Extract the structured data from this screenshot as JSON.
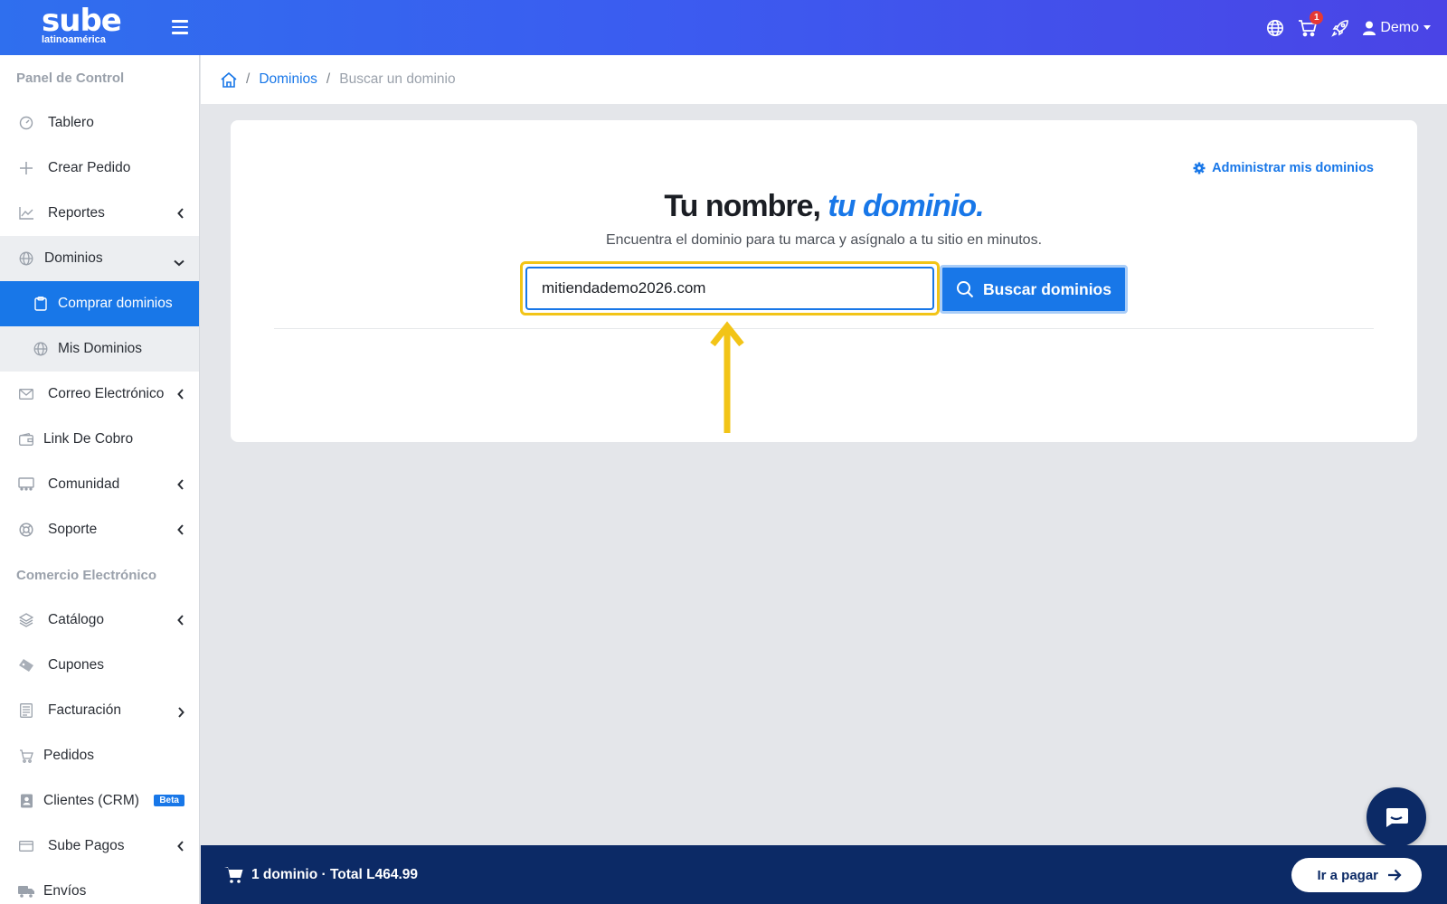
{
  "header": {
    "logo_main": "sube",
    "logo_sub": "latinoamérica",
    "cart_badge": "1",
    "user_name": "Demo"
  },
  "sidebar": {
    "section1_title": "Panel de Control",
    "items1": [
      {
        "label": "Tablero",
        "icon": "gauge-icon"
      },
      {
        "label": "Crear Pedido",
        "icon": "plus-icon"
      },
      {
        "label": "Reportes",
        "icon": "chart-line-icon"
      },
      {
        "label": "Dominios",
        "icon": "globe-icon"
      },
      {
        "label": "Comprar dominios",
        "icon": "clipboard-icon"
      },
      {
        "label": "Mis Dominios",
        "icon": "globe-icon"
      },
      {
        "label": "Correo Electrónico",
        "icon": "envelope-icon"
      },
      {
        "label": "Link De Cobro",
        "icon": "wallet-icon"
      },
      {
        "label": "Comunidad",
        "icon": "community-icon"
      },
      {
        "label": "Soporte",
        "icon": "lifebuoy-icon"
      }
    ],
    "section2_title": "Comercio Electrónico",
    "items2": [
      {
        "label": "Catálogo",
        "icon": "layers-icon"
      },
      {
        "label": "Cupones",
        "icon": "ticket-icon"
      },
      {
        "label": "Facturación",
        "icon": "invoice-icon"
      },
      {
        "label": "Pedidos",
        "icon": "cart-icon"
      },
      {
        "label": "Clientes (CRM)",
        "icon": "contact-icon",
        "badge": "Beta"
      },
      {
        "label": "Sube Pagos",
        "icon": "credit-card-icon"
      },
      {
        "label": "Envíos",
        "icon": "truck-icon"
      }
    ]
  },
  "breadcrumb": {
    "link": "Dominios",
    "current": "Buscar un dominio"
  },
  "main": {
    "manage_link": "Administrar mis dominios",
    "headline_plain": "Tu nombre,",
    "headline_accent": "tu dominio.",
    "subheadline": "Encuentra el dominio para tu marca y asígnalo a tu sitio en minutos.",
    "search_value": "mitiendademo2026.com",
    "search_button": "Buscar dominios"
  },
  "footer": {
    "cart_summary": "1 dominio · Total L464.99",
    "pay_button": "Ir a pagar"
  },
  "colors": {
    "accent": "#1877e8",
    "navy": "#0c2a66",
    "highlight": "#f2c417"
  }
}
